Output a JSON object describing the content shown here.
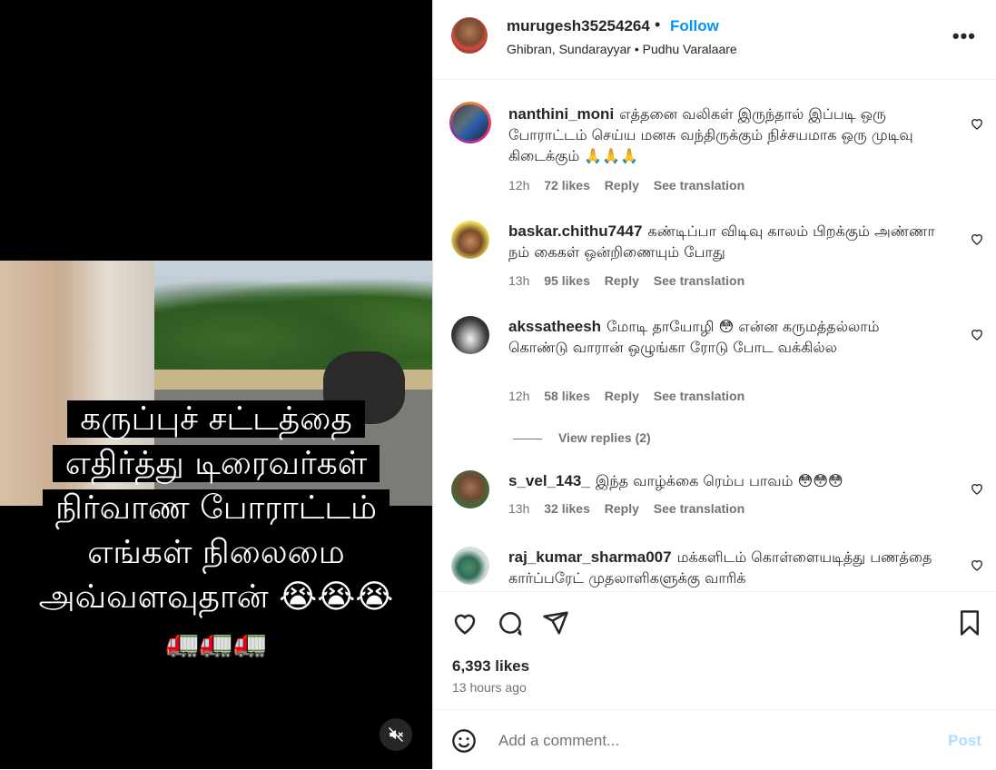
{
  "post": {
    "username": "murugesh35254264",
    "separator_dot": "•",
    "follow_label": "Follow",
    "audio_artists": "Ghibran, Sundarayyar",
    "audio_track": "Pudhu Varalaare",
    "sub_separator": "•",
    "more_icon": "more-horizontal-icon",
    "more_label": "•••"
  },
  "media": {
    "caption_lines": [
      "கருப்புச் சட்டத்தை",
      "எதிர்த்து டிரைவர்கள்",
      "நிர்வாண போராட்டம்",
      "எங்கள் நிலைமை",
      "அவ்வளவுதான் 😭😭😭"
    ],
    "caption_trucks": "🚛🚛🚛",
    "mute_icon": "muted-speaker-icon"
  },
  "comments": [
    {
      "username": "nanthini_moni",
      "text": "எத்தனை வலிகள் இருந்தால் இப்படி ஒரு போராட்டம் செய்ய மனசு வந்திருக்கும் நிச்சயமாக ஒரு முடிவு கிடைக்கும் 🙏🙏🙏",
      "time": "12h",
      "likes": "72 likes",
      "reply": "Reply",
      "translate": "See translation"
    },
    {
      "username": "baskar.chithu7447",
      "text": "கண்டிப்பா விடிவு காலம் பிறக்கும் அண்ணா நம் கைகள் ஒன்றிணையும் போது",
      "time": "13h",
      "likes": "95 likes",
      "reply": "Reply",
      "translate": "See translation"
    },
    {
      "username": "akssatheesh",
      "text": "மோடி தாயோழி 😳 என்ன கருமத்தல்லாம் கொண்டு வாரான் ஒழுங்கா ரோடு போட வக்கில்ல",
      "time": "12h",
      "likes": "58 likes",
      "reply": "Reply",
      "translate": "See translation"
    },
    {
      "username": "s_vel_143_",
      "text": "இந்த வாழ்க்கை ரெம்ப பாவம் 😳😳😳",
      "time": "13h",
      "likes": "32 likes",
      "reply": "Reply",
      "translate": "See translation"
    },
    {
      "username": "raj_kumar_sharma007",
      "text": "மக்களிடம் கொள்ளையடித்து பணத்தை கார்ப்பரேட் முதலாளிகளுக்கு வாரிக்",
      "time": "",
      "likes": "",
      "reply": "",
      "translate": ""
    }
  ],
  "view_replies": "View replies (2)",
  "actions": {
    "like_icon": "heart-icon",
    "comment_icon": "comment-icon",
    "share_icon": "share-icon",
    "save_icon": "bookmark-icon"
  },
  "stats": {
    "likes": "6,393 likes",
    "posted": "13 hours ago"
  },
  "add_comment": {
    "emoji_icon": "emoji-icon",
    "placeholder": "Add a comment...",
    "post_label": "Post"
  },
  "colors": {
    "accent": "#0095f6",
    "post_disabled": "#b3dbff",
    "muted_text": "#737373"
  }
}
